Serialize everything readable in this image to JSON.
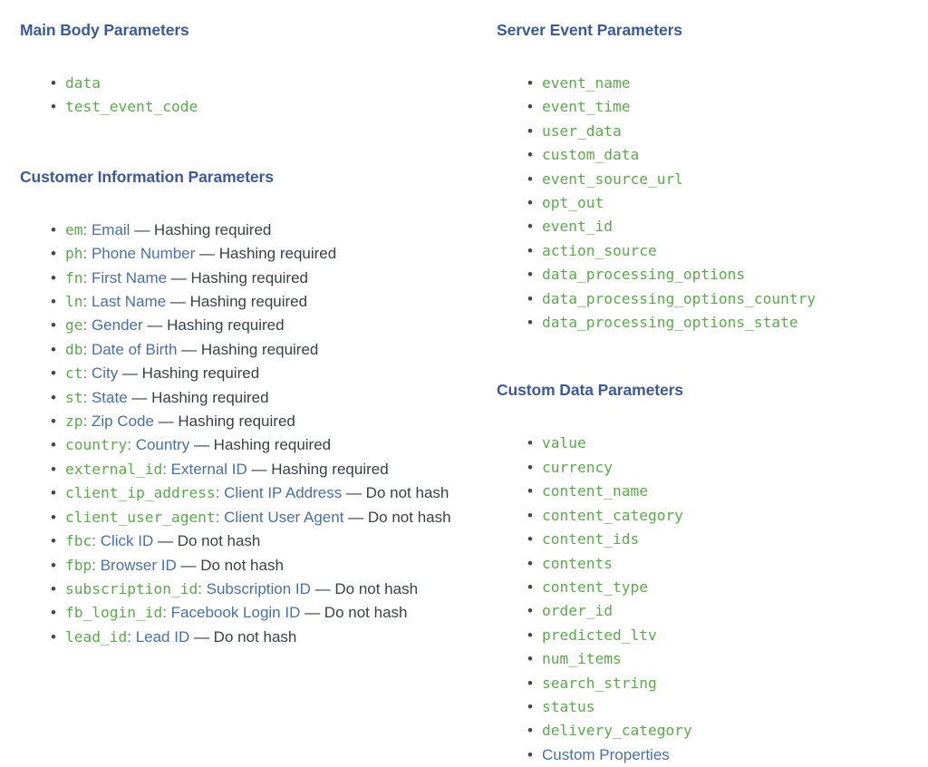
{
  "colors": {
    "heading": "#3c5a99",
    "code_green": "#5ca94d",
    "link_blue": "#4a6fa5",
    "note_gray": "#3b4045",
    "background": "#ffffff"
  },
  "left_column": {
    "sections": [
      {
        "heading": "Main Body Parameters",
        "items": [
          {
            "code": "data"
          },
          {
            "code": "test_event_code"
          }
        ]
      },
      {
        "heading": "Customer Information Parameters",
        "items": [
          {
            "code": "em",
            "colon": ":",
            "label": "Email",
            "note": "— Hashing required"
          },
          {
            "code": "ph",
            "colon": ":",
            "label": "Phone Number",
            "note": "— Hashing required"
          },
          {
            "code": "fn",
            "colon": ":",
            "label": "First Name",
            "note": "— Hashing required"
          },
          {
            "code": "ln",
            "colon": ":",
            "label": "Last Name",
            "note": "— Hashing required"
          },
          {
            "code": "ge",
            "colon": ":",
            "label": "Gender",
            "note": "— Hashing required"
          },
          {
            "code": "db",
            "colon": ":",
            "label": "Date of Birth",
            "note": "— Hashing required"
          },
          {
            "code": "ct",
            "colon": ":",
            "label": "City",
            "note": "— Hashing required"
          },
          {
            "code": "st",
            "colon": ":",
            "label": "State",
            "note": "— Hashing required"
          },
          {
            "code": "zp",
            "colon": ":",
            "label": "Zip Code",
            "note": "— Hashing required"
          },
          {
            "code": "country",
            "colon": ":",
            "label": "Country",
            "note": "— Hashing required"
          },
          {
            "code": "external_id",
            "colon": ":",
            "label": "External ID",
            "note": "— Hashing required"
          },
          {
            "code": "client_ip_address",
            "colon": ":",
            "label": "Client IP Address",
            "note": "— Do not hash"
          },
          {
            "code": "client_user_agent",
            "colon": ":",
            "label": "Client User Agent",
            "note": "— Do not hash"
          },
          {
            "code": "fbc",
            "colon": ":",
            "label": "Click ID",
            "note": "— Do not hash"
          },
          {
            "code": "fbp",
            "colon": ":",
            "label": "Browser ID",
            "note": "— Do not hash"
          },
          {
            "code": "subscription_id",
            "colon": ":",
            "label": "Subscription ID",
            "note": "— Do not hash"
          },
          {
            "code": "fb_login_id",
            "colon": ":",
            "label": "Facebook Login ID",
            "note": "— Do not hash"
          },
          {
            "code": "lead_id",
            "colon": ":",
            "label": "Lead ID",
            "note": "— Do not hash"
          }
        ]
      }
    ]
  },
  "right_column": {
    "sections": [
      {
        "heading": "Server Event Parameters",
        "items": [
          {
            "code": "event_name"
          },
          {
            "code": "event_time"
          },
          {
            "code": "user_data"
          },
          {
            "code": "custom_data"
          },
          {
            "code": "event_source_url"
          },
          {
            "code": "opt_out"
          },
          {
            "code": "event_id"
          },
          {
            "code": "action_source"
          },
          {
            "code": "data_processing_options"
          },
          {
            "code": "data_processing_options_country"
          },
          {
            "code": "data_processing_options_state"
          }
        ]
      },
      {
        "heading": "Custom Data Parameters",
        "items": [
          {
            "code": "value"
          },
          {
            "code": "currency"
          },
          {
            "code": "content_name"
          },
          {
            "code": "content_category"
          },
          {
            "code": "content_ids"
          },
          {
            "code": "contents"
          },
          {
            "code": "content_type"
          },
          {
            "code": "order_id"
          },
          {
            "code": "predicted_ltv"
          },
          {
            "code": "num_items"
          },
          {
            "code": "search_string"
          },
          {
            "code": "status"
          },
          {
            "code": "delivery_category"
          },
          {
            "label": "Custom Properties"
          }
        ]
      }
    ]
  }
}
